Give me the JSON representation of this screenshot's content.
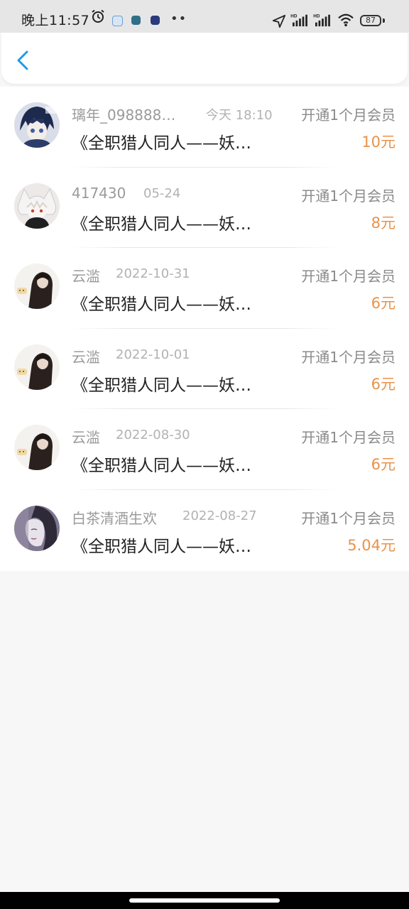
{
  "status_bar": {
    "time": "晚上11:57",
    "battery": "87",
    "icons": [
      "alarm-icon",
      "app-notif-icon",
      "app-notif-icon",
      "app-notif-icon",
      "more-icon",
      "location-icon",
      "hd-signal-icon",
      "hd-signal-icon",
      "wifi-icon",
      "battery-icon"
    ]
  },
  "header": {
    "back_icon": "chevron-left-icon",
    "accent_color": "#1e9be9"
  },
  "colors": {
    "amount": "#e8934a",
    "meta": "#9a9a9a",
    "title": "#222222"
  },
  "records": [
    {
      "username": "璃年_098888…",
      "date": "今天 18:10",
      "action": "开通1个月会员",
      "book": "《全职猎人同人——妖…",
      "amount": "10元",
      "avatar": "anime-boy-blue"
    },
    {
      "username": "417430",
      "date": "05-24",
      "action": "开通1个月会员",
      "book": "《全职猎人同人——妖…",
      "amount": "8元",
      "avatar": "anime-white-hair"
    },
    {
      "username": "云滥",
      "date": "2022-10-31",
      "action": "开通1个月会员",
      "book": "《全职猎人同人——妖…",
      "amount": "6元",
      "avatar": "dark-figure"
    },
    {
      "username": "云滥",
      "date": "2022-10-01",
      "action": "开通1个月会员",
      "book": "《全职猎人同人——妖…",
      "amount": "6元",
      "avatar": "dark-figure"
    },
    {
      "username": "云滥",
      "date": "2022-08-30",
      "action": "开通1个月会员",
      "book": "《全职猎人同人——妖…",
      "amount": "6元",
      "avatar": "dark-figure"
    },
    {
      "username": "白茶清酒生欢",
      "date": "2022-08-27",
      "action": "开通1个月会员",
      "book": "《全职猎人同人——妖…",
      "amount": "5.04元",
      "avatar": "purple-portrait"
    }
  ]
}
